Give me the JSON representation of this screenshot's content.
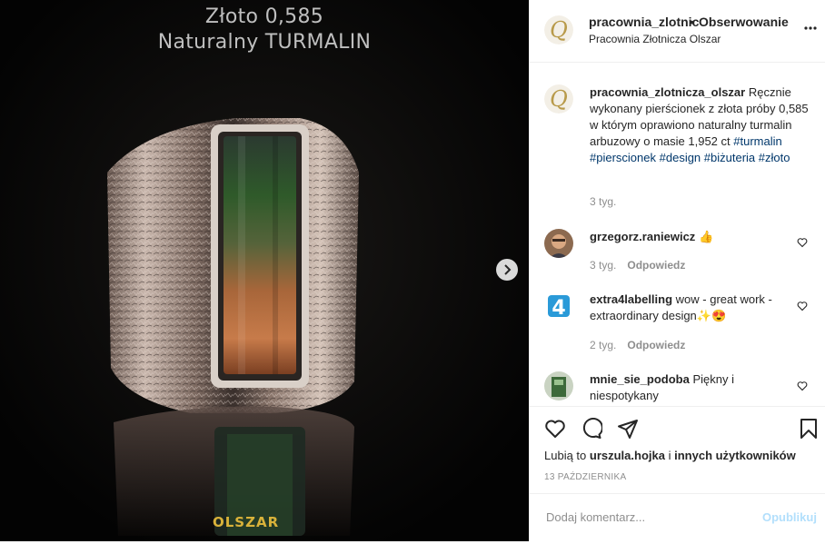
{
  "media": {
    "title_line1": "Złoto 0,585",
    "title_line2": "Naturalny TURMALIN",
    "brand": "OLSZAR"
  },
  "header": {
    "username": "pracownia_zlotnic",
    "separator": "•",
    "follow_label": "Obserwowanie",
    "subtitle": "Pracownia Złotnicza Olszar"
  },
  "caption": {
    "username": "pracownia_zlotnicza_olszar",
    "text": "Ręcznie wykonany pierścionek z złota próby 0,585 w którym oprawiono naturalny turmalin arbuzowy o masie 1,952 ct",
    "hashtags": [
      "#turmalin",
      "#pierscionek",
      "#design",
      "#biżuteria",
      "#złoto"
    ],
    "time": "3 tyg."
  },
  "comments": [
    {
      "username": "grzegorz.raniewicz",
      "text": "👍",
      "time": "3 tyg.",
      "reply": "Odpowiedz"
    },
    {
      "username": "extra4labelling",
      "text": "wow - great work - extraordinary design✨😍",
      "time": "2 tyg.",
      "reply": "Odpowiedz"
    },
    {
      "username": "mnie_sie_podoba",
      "text": "Piękny i niespotykany"
    }
  ],
  "likes": {
    "prefix": "Lubią to",
    "user": "urszula.hojka",
    "middle": "i",
    "others": "innych użytkowników"
  },
  "date": "13 PAŹDZIERNIKA",
  "add_comment": {
    "placeholder": "Dodaj komentarz...",
    "publish": "Opublikuj"
  },
  "colors": {
    "link": "#00376b",
    "publish_disabled": "#b2dffc",
    "muted": "#8e8e8e"
  },
  "icons": [
    "chevron-right-icon",
    "more-icon",
    "heart-icon",
    "comment-icon",
    "share-icon",
    "bookmark-icon"
  ]
}
